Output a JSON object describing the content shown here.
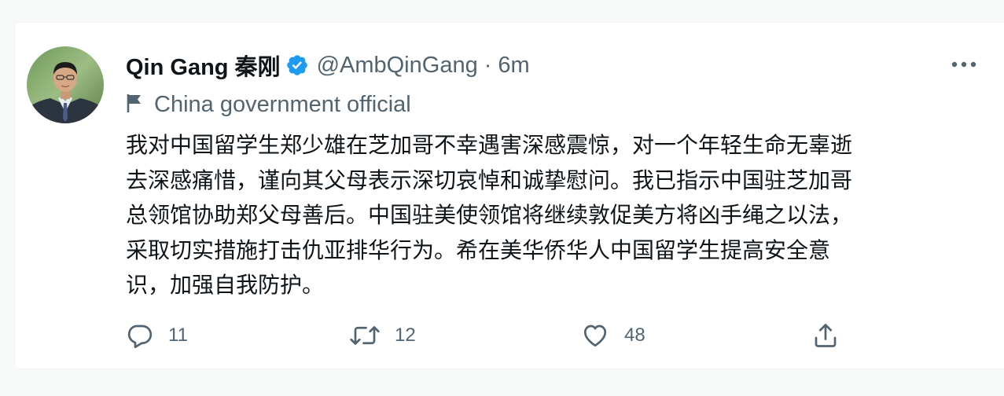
{
  "tweet": {
    "author_name": "Qin Gang 秦刚",
    "verified_icon": "verified-badge-icon",
    "handle": "@AmbQinGang",
    "separator": "·",
    "time": "6m",
    "more_icon": "more-options-icon",
    "label_icon": "flag-icon",
    "label": "China government official",
    "text_lines": [
      "我对中国留学生郑少雄在芝加哥不幸遇害深感震惊，对一个年轻生命无辜逝",
      "去深感痛惜，谨向其父母表示深切哀悼和诚挚慰问。我已指示中国驻芝加哥",
      "总领馆协助郑父母善后。中国驻美使领馆将继续敦促美方将凶手绳之以法，",
      "采取切实措施打击仇亚排华行为。希在美华侨华人中国留学生提高安全意",
      "识，加强自我防护。"
    ],
    "actions": {
      "reply_icon": "reply-icon",
      "reply_count": "11",
      "retweet_icon": "retweet-icon",
      "retweet_count": "12",
      "like_icon": "heart-icon",
      "like_count": "48",
      "share_icon": "share-icon"
    }
  },
  "colors": {
    "verified": "#1d9bf0",
    "text_primary": "#0f1419",
    "text_secondary": "#536471"
  }
}
